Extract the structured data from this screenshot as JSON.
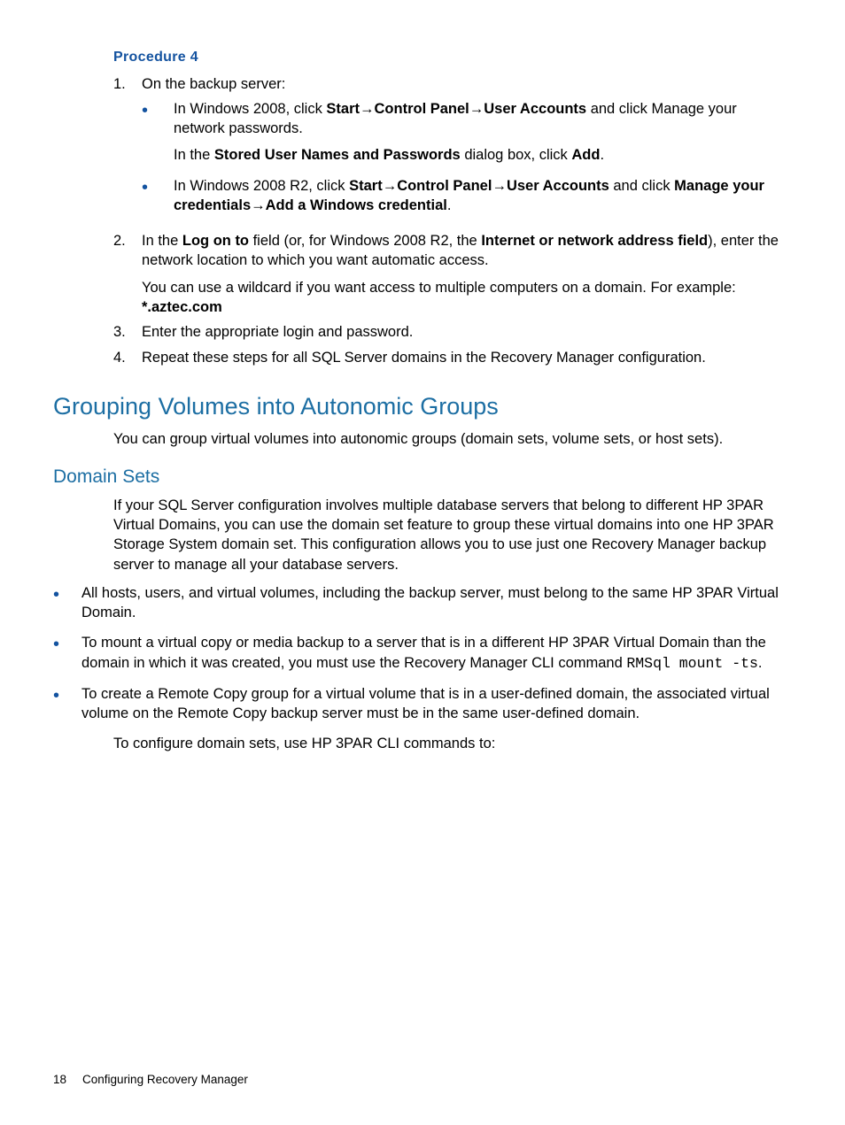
{
  "proc_heading": "Procedure 4",
  "ol": {
    "i1": {
      "num": "1.",
      "lead": "On the backup server:",
      "sub1_a": "In Windows 2008, click ",
      "sub1_b_start": "Start",
      "sub1_arrow1": "→",
      "sub1_b_cp": "Control Panel",
      "sub1_arrow2": "→",
      "sub1_b_ua": "User Accounts",
      "sub1_c": " and click Manage your network passwords.",
      "sub1_p2a": "In the ",
      "sub1_p2b": "Stored User Names and Passwords",
      "sub1_p2c": " dialog box, click ",
      "sub1_p2d": "Add",
      "sub1_p2e": ".",
      "sub2_a": "In Windows 2008 R2, click ",
      "sub2_b_start": "Start",
      "sub2_arrow1": "→",
      "sub2_b_cp": "Control Panel",
      "sub2_arrow2": "→",
      "sub2_b_ua": "User Accounts",
      "sub2_c": " and click ",
      "sub2_d": "Manage your credentials",
      "sub2_arrow3": "→",
      "sub2_e": "Add a Windows credential",
      "sub2_f": "."
    },
    "i2": {
      "num": "2.",
      "a": "In the ",
      "b": "Log on to",
      "c": " field (or, for Windows 2008 R2, the ",
      "d": "Internet or network address field",
      "e": "), enter the network location to which you want automatic access.",
      "p2a": "You can use a wildcard if you want access to multiple computers on a domain. For example: ",
      "p2b": "*.aztec.com"
    },
    "i3": {
      "num": "3.",
      "text": "Enter the appropriate login and password."
    },
    "i4": {
      "num": "4.",
      "text": "Repeat these steps for all SQL Server domains in the Recovery Manager configuration."
    }
  },
  "h2_grouping": "Grouping Volumes into Autonomic Groups",
  "grouping_intro": "You can group virtual volumes into autonomic groups (domain sets, volume sets, or host sets).",
  "h3_domain_sets": "Domain Sets",
  "ds_intro": "If your SQL Server configuration involves multiple database servers that belong to different HP 3PAR Virtual Domains, you can use the domain set feature to group these virtual domains into one HP 3PAR Storage System domain set. This configuration allows you to use just one Recovery Manager backup server to manage all your database servers.",
  "ds_b1": "All hosts, users, and virtual volumes, including the backup server, must belong to the same HP 3PAR Virtual Domain.",
  "ds_b2a": "To mount a virtual copy or media backup to a server that is in a different HP 3PAR Virtual Domain than the domain in which it was created, you must use the Recovery Manager CLI command ",
  "ds_b2b": "RMSql mount -ts",
  "ds_b2c": ".",
  "ds_b3": "To create a Remote Copy group for a virtual volume that is in a user-defined domain, the associated virtual volume on the Remote Copy backup server must be in the same user-defined domain.",
  "ds_tail": "To configure domain sets, use HP 3PAR CLI commands to:",
  "footer": {
    "page": "18",
    "section": "Configuring Recovery Manager"
  }
}
